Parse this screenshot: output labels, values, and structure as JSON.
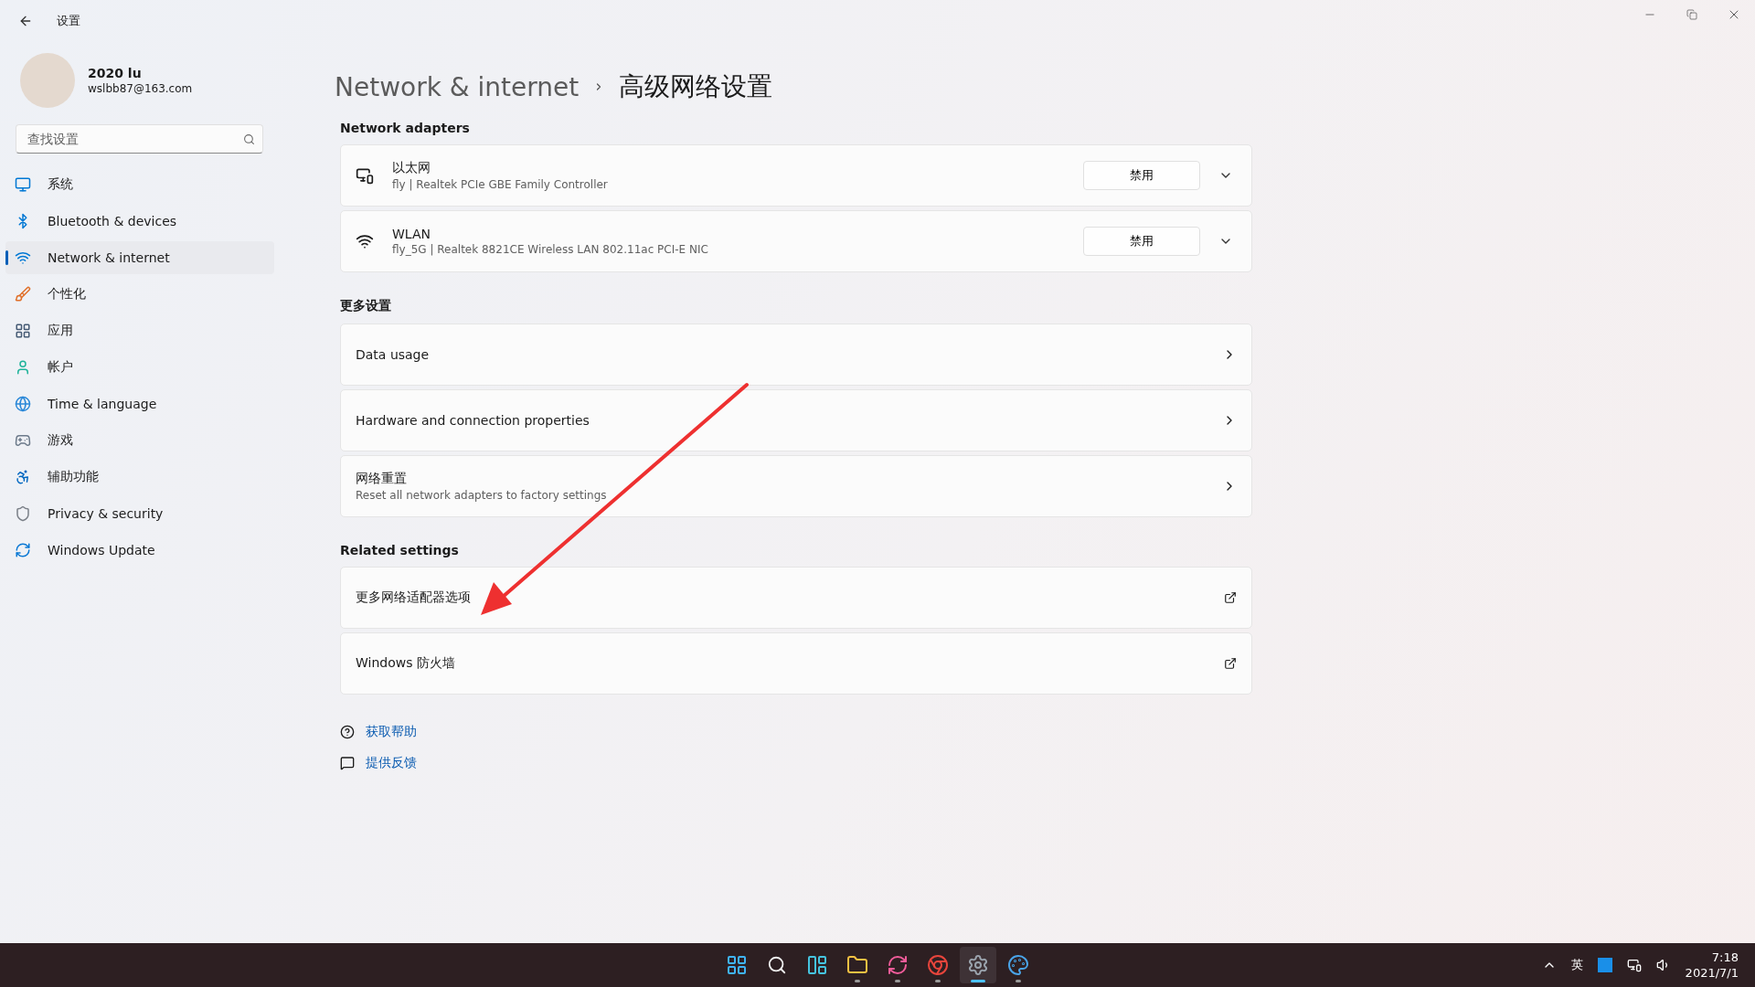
{
  "window": {
    "title": "设置"
  },
  "user": {
    "name": "2020 lu",
    "email": "wslbb87@163.com"
  },
  "search": {
    "placeholder": "查找设置"
  },
  "sidebar": {
    "items": [
      {
        "label": "系统",
        "selected": false
      },
      {
        "label": "Bluetooth & devices",
        "selected": false
      },
      {
        "label": "Network & internet",
        "selected": true
      },
      {
        "label": "个性化",
        "selected": false
      },
      {
        "label": "应用",
        "selected": false
      },
      {
        "label": "帐户",
        "selected": false
      },
      {
        "label": "Time & language",
        "selected": false
      },
      {
        "label": "游戏",
        "selected": false
      },
      {
        "label": "辅助功能",
        "selected": false
      },
      {
        "label": "Privacy & security",
        "selected": false
      },
      {
        "label": "Windows Update",
        "selected": false
      }
    ]
  },
  "breadcrumb": {
    "parent": "Network & internet",
    "current": "高级网络设置"
  },
  "network_adapters": {
    "heading": "Network adapters",
    "items": [
      {
        "name": "以太网",
        "detail": "fly | Realtek PCIe GBE Family Controller",
        "button": "禁用",
        "expanded": false
      },
      {
        "name": "WLAN",
        "detail": "fly_5G | Realtek 8821CE Wireless LAN 802.11ac PCI-E NIC",
        "button": "禁用",
        "expanded": false
      }
    ]
  },
  "more_settings": {
    "heading": "更多设置",
    "items": [
      {
        "title": "Data usage"
      },
      {
        "title": "Hardware and connection properties"
      },
      {
        "title": "网络重置",
        "subtitle": "Reset all network adapters to factory settings"
      }
    ]
  },
  "related_settings": {
    "heading": "Related settings",
    "items": [
      {
        "title": "更多网络适配器选项"
      },
      {
        "title": "Windows 防火墙"
      }
    ]
  },
  "help_links": [
    "获取帮助",
    "提供反馈"
  ],
  "taskbar": {
    "apps": [
      {
        "running": false,
        "selected": false
      },
      {
        "running": false,
        "selected": false
      },
      {
        "running": false,
        "selected": false
      },
      {
        "running": true,
        "selected": false
      },
      {
        "running": true,
        "selected": false
      },
      {
        "running": true,
        "selected": false
      },
      {
        "running": true,
        "selected": true
      },
      {
        "running": true,
        "selected": false
      }
    ],
    "input_method": "英",
    "time": "7:18",
    "date": "2021/7/1"
  }
}
